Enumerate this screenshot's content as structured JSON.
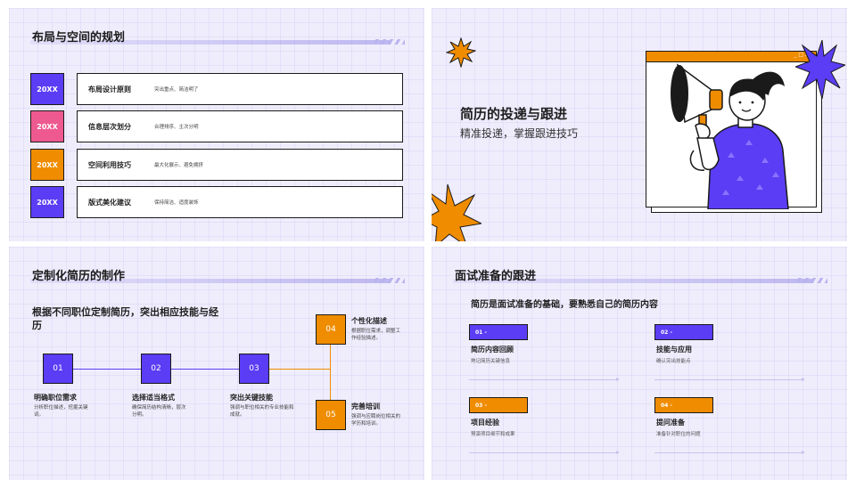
{
  "colors": {
    "purple": "#5b3df5",
    "pink": "#ee5a8f",
    "orange": "#f08c00",
    "bg": "#efedfc",
    "line": "#5b3df5"
  },
  "slide1": {
    "title": "布局与空间的规划",
    "rows": [
      {
        "tag": "20XX",
        "name": "布局设计原则",
        "desc": "突出重点、简洁明了",
        "color": "#5b3df5"
      },
      {
        "tag": "20XX",
        "name": "信息层次划分",
        "desc": "合理排序、主次分明",
        "color": "#ee5a8f"
      },
      {
        "tag": "20XX",
        "name": "空间利用技巧",
        "desc": "最大化展示、避免拥挤",
        "color": "#f08c00"
      },
      {
        "tag": "20XX",
        "name": "版式美化建议",
        "desc": "保持简洁、适度装饰",
        "color": "#5b3df5"
      }
    ]
  },
  "slide2": {
    "title": "简历的投递与跟进",
    "subtitle": "精准投递，掌握跟进技巧",
    "window_controls": "_ □ X"
  },
  "slide3": {
    "title": "定制化简历的制作",
    "heading": "根据不同职位定制简历，突出相应技能与经历",
    "steps": [
      {
        "num": "01",
        "title": "明确职位需求",
        "desc": "分析职位描述，挖掘关键词。"
      },
      {
        "num": "02",
        "title": "选择适当格式",
        "desc": "确保简历结构清晰，层次分明。"
      },
      {
        "num": "03",
        "title": "突出关键技能",
        "desc": "强调与职位相关的专业技能和成就。"
      },
      {
        "num": "04",
        "title": "个性化描述",
        "desc": "根据职位需求，调整工作经验描述。"
      },
      {
        "num": "05",
        "title": "完善培训",
        "desc": "强调与应聘岗位相关的学历和培训。"
      }
    ]
  },
  "slide4": {
    "title": "面试准备的跟进",
    "heading": "简历是面试准备的基础，要熟悉自己的简历内容",
    "items": [
      {
        "num": "01 -",
        "title": "简历内容回顾",
        "desc": "熟记简历关键信息",
        "color": "#5b3df5"
      },
      {
        "num": "02 -",
        "title": "技能与应用",
        "desc": "确认突出技能点",
        "color": "#5b3df5"
      },
      {
        "num": "03 -",
        "title": "项目经验",
        "desc": "预演项目细节和成果",
        "color": "#f08c00"
      },
      {
        "num": "04 -",
        "title": "提问准备",
        "desc": "准备针对职位的问题",
        "color": "#f08c00"
      }
    ]
  }
}
